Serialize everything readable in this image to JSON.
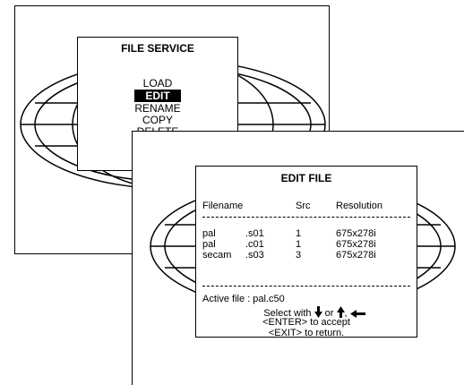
{
  "file_service": {
    "title": "FILE SERVICE",
    "items": [
      "LOAD",
      "EDIT",
      "RENAME",
      "COPY",
      "DELETE"
    ],
    "selected": "EDIT"
  },
  "edit_file": {
    "title": "EDIT FILE",
    "headers": {
      "filename": "Filename",
      "src": "Src",
      "resolution": "Resolution"
    },
    "rows": [
      {
        "name": "pal",
        "ext": ".s01",
        "src": "1",
        "resolution": "675x278i"
      },
      {
        "name": "pal",
        "ext": ".c01",
        "src": "1",
        "resolution": "675x278i"
      },
      {
        "name": "secam",
        "ext": ".s03",
        "src": "3",
        "resolution": "675x278i"
      }
    ],
    "active_file": "Active file : pal.c50",
    "select_with": "Select with",
    "or": "or",
    "comma": ",",
    "enter_hint": "<ENTER> to accept",
    "exit_hint": "<EXIT> to return."
  },
  "icons": [
    "arrow-down-icon",
    "arrow-up-icon",
    "arrow-left-icon"
  ]
}
